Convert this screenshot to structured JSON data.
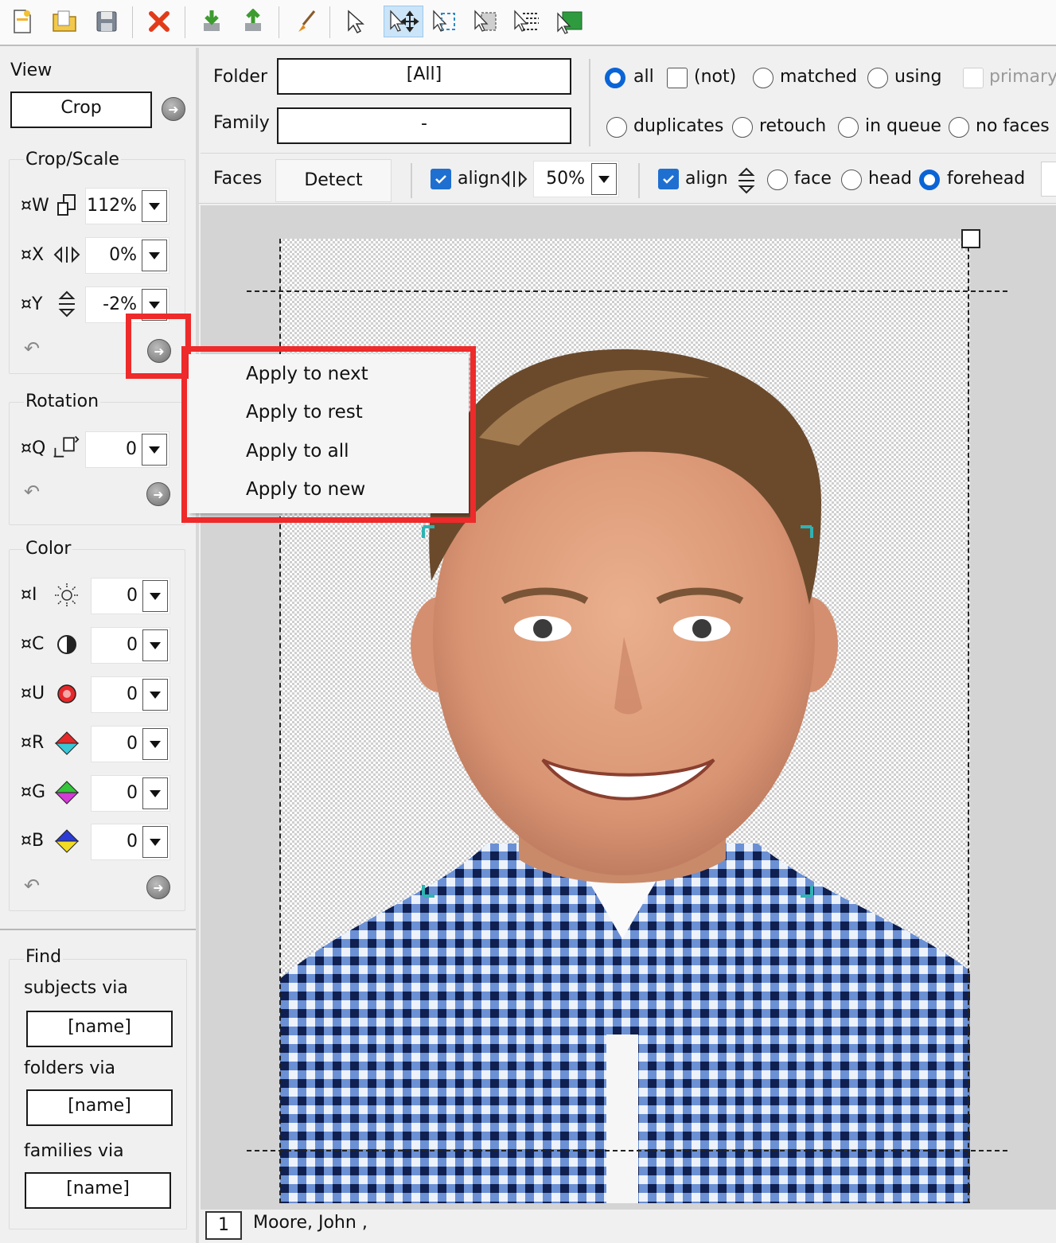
{
  "toolbar": {
    "icons": [
      "new-file-icon",
      "open-folder-icon",
      "save-icon",
      "delete-icon",
      "import-icon",
      "export-icon",
      "brush-icon",
      "pointer-icon",
      "move-tool-icon",
      "select-region-icon",
      "select-area-icon",
      "select-rows-icon",
      "select-fill-icon"
    ]
  },
  "sidebar": {
    "view_label": "View",
    "view_value": "Crop",
    "crop_title": "Crop/Scale",
    "crop_w": {
      "label": "¤W",
      "value": "112%"
    },
    "crop_x": {
      "label": "¤X",
      "value": "0%"
    },
    "crop_y": {
      "label": "¤Y",
      "value": "-2%"
    },
    "rotation_title": "Rotation",
    "rotation_q": {
      "label": "¤Q",
      "value": "0"
    },
    "color_title": "Color",
    "color_i": {
      "label": "¤I",
      "value": "0"
    },
    "color_c": {
      "label": "¤C",
      "value": "0"
    },
    "color_u": {
      "label": "¤U",
      "value": "0"
    },
    "color_r": {
      "label": "¤R",
      "value": "0"
    },
    "color_g": {
      "label": "¤G",
      "value": "0"
    },
    "color_b": {
      "label": "¤B",
      "value": "0"
    },
    "find_title": "Find",
    "subjects_label": "subjects via",
    "subjects_value": "[name]",
    "folders_label": "folders via",
    "folders_value": "[name]",
    "families_label": "families via",
    "families_value": "[name]"
  },
  "filters": {
    "folder_label": "Folder",
    "folder_value": "[All]",
    "family_label": "Family",
    "family_value": "-",
    "all": "all",
    "not": "(not)",
    "matched": "matched",
    "using": "using",
    "primary": "primary",
    "duplicates": "duplicates",
    "retouch": "retouch",
    "in_queue": "in queue",
    "no_faces": "no faces"
  },
  "faces": {
    "label": "Faces",
    "detect": "Detect",
    "align_h": "align",
    "align_h_value": "50%",
    "align_v": "align",
    "face": "face",
    "head": "head",
    "forehead": "forehead"
  },
  "status": {
    "index": "1",
    "name": "Moore, John ,"
  },
  "context_menu": {
    "items": [
      "Apply to next",
      "Apply to rest",
      "Apply to all",
      "Apply to new"
    ]
  },
  "colors": {
    "highlight": "#ee2a2a",
    "radio_selected": "#0a64d6",
    "checkbox": "#1f6fd1",
    "crop_marker": "#2fb3b3"
  }
}
